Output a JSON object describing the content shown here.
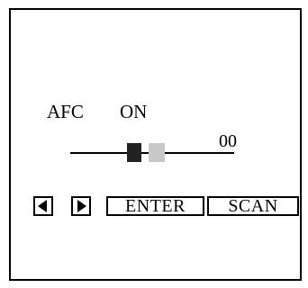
{
  "afc": {
    "label": "AFC",
    "value": "ON"
  },
  "tuning": {
    "value_text": "00",
    "level": 0.45
  },
  "buttons": {
    "left_icon": "left-triangle-icon",
    "right_icon": "right-triangle-icon",
    "enter_label": "ENTER",
    "scan_label": "SCAN"
  },
  "colors": {
    "background": "#ffffff",
    "ink": "#000000",
    "thumb": "#222222",
    "ghost": "#c8c8c8"
  }
}
